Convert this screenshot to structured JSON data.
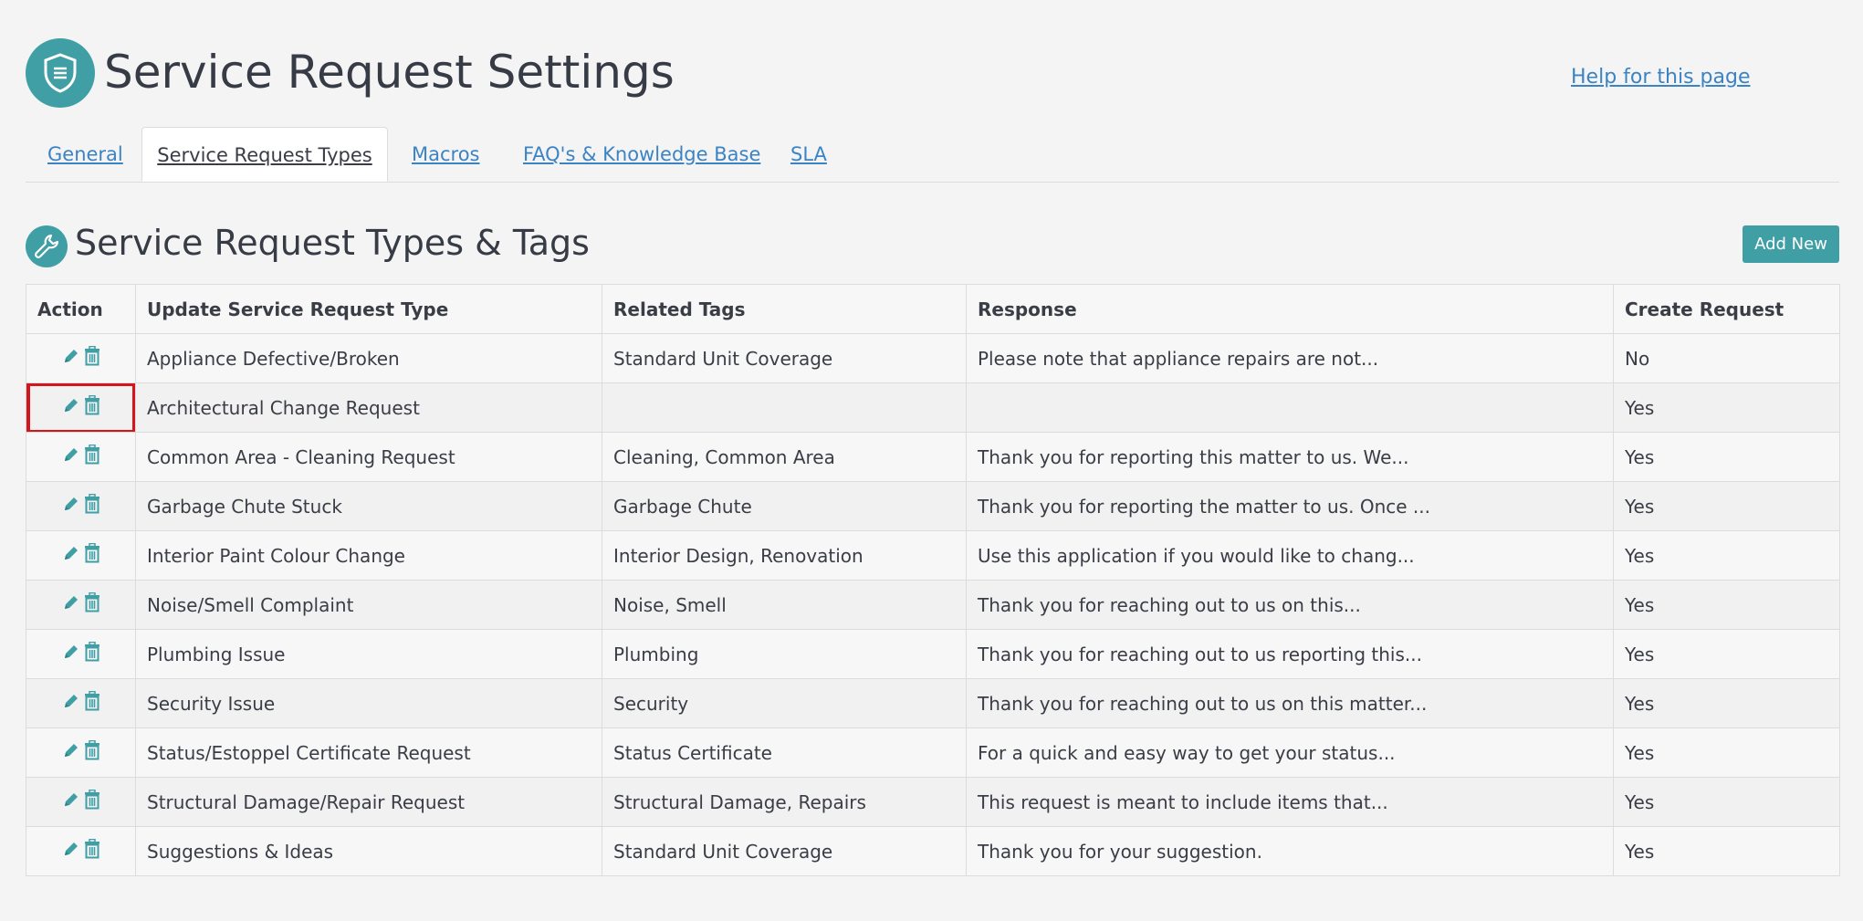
{
  "page": {
    "title": "Service Request Settings",
    "help_link": "Help for this page"
  },
  "tabs": [
    {
      "label": "General",
      "active": false
    },
    {
      "label": "Service Request Types",
      "active": true
    },
    {
      "label": "Macros",
      "active": false
    },
    {
      "label": "FAQ's & Knowledge Base",
      "active": false
    },
    {
      "label": "SLA",
      "active": false
    }
  ],
  "section": {
    "title": "Service Request Types & Tags",
    "add_button": "Add New"
  },
  "table": {
    "headers": [
      "Action",
      "Update Service Request Type",
      "Related Tags",
      "Response",
      "Create Request"
    ],
    "rows": [
      {
        "type": "Appliance Defective/Broken",
        "tags": "Standard Unit Coverage",
        "response": "Please note that appliance repairs are not...",
        "create": "No"
      },
      {
        "type": "Architectural Change Request",
        "tags": "",
        "response": "",
        "create": "Yes",
        "highlighted": true
      },
      {
        "type": "Common Area - Cleaning Request",
        "tags": "Cleaning, Common Area",
        "response": "Thank you for reporting this matter to us. We...",
        "create": "Yes"
      },
      {
        "type": "Garbage Chute Stuck",
        "tags": "Garbage Chute",
        "response": "Thank you for reporting the matter to us. Once ...",
        "create": "Yes"
      },
      {
        "type": "Interior Paint Colour Change",
        "tags": "Interior Design, Renovation",
        "response": "Use this application if you would like to chang...",
        "create": "Yes"
      },
      {
        "type": "Noise/Smell Complaint",
        "tags": "Noise, Smell",
        "response": "Thank you for reaching out to us on this...",
        "create": "Yes"
      },
      {
        "type": "Plumbing Issue",
        "tags": "Plumbing",
        "response": "Thank you for reaching out to us reporting this...",
        "create": "Yes"
      },
      {
        "type": "Security Issue",
        "tags": "Security",
        "response": "Thank you for reaching out to us on this matter...",
        "create": "Yes"
      },
      {
        "type": "Status/Estoppel Certificate Request",
        "tags": "Status Certificate",
        "response": "For a quick and easy way to get your status...",
        "create": "Yes"
      },
      {
        "type": "Structural Damage/Repair Request",
        "tags": "Structural Damage, Repairs",
        "response": "This request is meant to include items that...",
        "create": "Yes"
      },
      {
        "type": "Suggestions & Ideas",
        "tags": "Standard Unit Coverage",
        "response": "Thank you for your suggestion.",
        "create": "Yes"
      }
    ]
  },
  "icons": {
    "header": "shield-icon",
    "section": "wrench-icon",
    "edit": "pencil-icon",
    "delete": "trash-icon"
  },
  "colors": {
    "accent": "#3f9fa5",
    "link": "#3c83c4",
    "highlight": "#d4161c"
  }
}
